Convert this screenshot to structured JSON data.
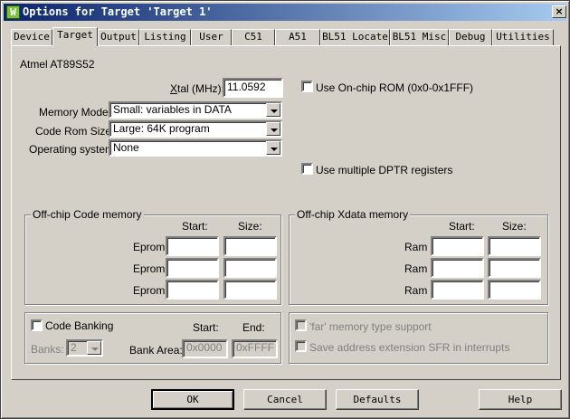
{
  "window": {
    "title": "Options for Target 'Target 1'",
    "icon_name": "keil-app-icon",
    "icon_glyph": "W",
    "close_glyph": "×"
  },
  "tabs": [
    {
      "label": "Device"
    },
    {
      "label": "Target",
      "active": true
    },
    {
      "label": "Output"
    },
    {
      "label": "Listing"
    },
    {
      "label": "User"
    },
    {
      "label": "C51"
    },
    {
      "label": "A51"
    },
    {
      "label": "BL51 Locate"
    },
    {
      "label": "BL51 Misc"
    },
    {
      "label": "Debug"
    },
    {
      "label": "Utilities"
    }
  ],
  "device_name": "Atmel AT89S52",
  "xtal": {
    "label_ul": "X",
    "label_rest": "tal (MHz):",
    "value": "11.0592"
  },
  "on_chip_rom": {
    "label": "Use On-chip ROM (0x0-0x1FFF)",
    "checked": false
  },
  "memory_model": {
    "label": "Memory Model:",
    "value": "Small: variables in DATA"
  },
  "code_rom_size": {
    "label": "Code Rom Size:",
    "value": "Large: 64K program"
  },
  "operating_system": {
    "label": "Operating system:",
    "value": "None"
  },
  "multiple_dptr": {
    "label": "Use multiple DPTR registers",
    "checked": false
  },
  "code_memory": {
    "title": "Off-chip Code memory",
    "start_header": "Start:",
    "size_header": "Size:",
    "rows": [
      {
        "label": "Eprom",
        "start": "",
        "size": ""
      },
      {
        "label": "Eprom",
        "start": "",
        "size": ""
      },
      {
        "label": "Eprom",
        "start": "",
        "size": ""
      }
    ]
  },
  "xdata_memory": {
    "title": "Off-chip Xdata memory",
    "start_header": "Start:",
    "size_header": "Size:",
    "rows": [
      {
        "label": "Ram",
        "start": "",
        "size": ""
      },
      {
        "label": "Ram",
        "start": "",
        "size": ""
      },
      {
        "label": "Ram",
        "start": "",
        "size": ""
      }
    ]
  },
  "banking": {
    "label": "Code Banking",
    "checked": false,
    "start_header": "Start:",
    "end_header": "End:",
    "banks_label": "Banks:",
    "banks_value": "2",
    "bank_area_label": "Bank Area:",
    "start_value": "0x0000",
    "end_value": "0xFFFF"
  },
  "far_memory": {
    "label": "'far' memory type support",
    "checked": false
  },
  "addr_ext_sfr": {
    "label": "Save address extension SFR in interrupts",
    "checked": false
  },
  "buttons": {
    "ok": "OK",
    "cancel": "Cancel",
    "defaults": "Defaults",
    "help": "Help"
  }
}
